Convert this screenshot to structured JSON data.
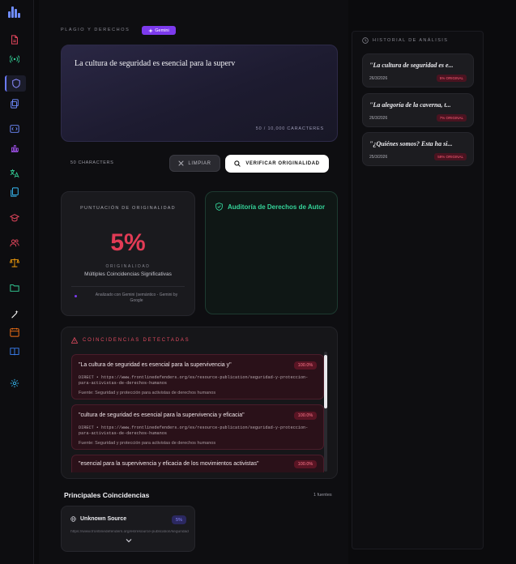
{
  "colors": {
    "accent": "#6b7bff",
    "danger": "#e23b55",
    "success": "#34d399",
    "gemini": "#7c3aed"
  },
  "sidebar": {
    "items": [
      {
        "name": "file-icon",
        "color": "#e2455c"
      },
      {
        "name": "broadcast-icon",
        "color": "#34d399"
      },
      {
        "name": "shield-icon",
        "color": "#8b8bff",
        "active": true
      },
      {
        "name": "copy-icon",
        "color": "#6f8cff"
      },
      {
        "name": "code-icon",
        "color": "#6f8cff"
      },
      {
        "name": "bar-chart-icon",
        "color": "#a855f7"
      },
      {
        "name": "translate-icon",
        "color": "#34d399"
      },
      {
        "name": "files-icon",
        "color": "#38bdf8"
      },
      {
        "name": "graduation-icon",
        "color": "#e2455c"
      },
      {
        "name": "users-icon",
        "color": "#e2455c"
      },
      {
        "name": "scale-icon",
        "color": "#f59e0b"
      },
      {
        "name": "folder-icon",
        "color": "#34d399"
      },
      {
        "name": "wand-icon",
        "color": "#ffffff"
      },
      {
        "name": "calendar-icon",
        "color": "#f97316"
      },
      {
        "name": "book-icon",
        "color": "#3b82f6"
      },
      {
        "name": "gear-icon",
        "color": "#38bdf8"
      }
    ]
  },
  "header": {
    "section": "Plagio y Derechos",
    "badge": "Gemini"
  },
  "editor": {
    "text": "La cultura de seguridad es esencial para la superv",
    "counter": "50 / 10,000 caracteres"
  },
  "toolbar": {
    "chars": "50 characters",
    "clear_label": "Limpiar",
    "verify_label": "Verificar originalidad"
  },
  "score": {
    "title": "Puntuación de Originalidad",
    "value": "5%",
    "label": "Originalidad",
    "message": "Múltiples Coincidencias Significativas",
    "analyzed": "Analizado con Gemini (semántico - Gemini by Google"
  },
  "audit": {
    "title": "Auditoría de Derechos de Autor"
  },
  "matches": {
    "title": "Coincidencias detectadas",
    "items": [
      {
        "quote": "\"La cultura de seguridad es esencial para la supervivencia y\"",
        "pct": "100.0%",
        "url": "DIRECT • https://www.frontlinedefenders.org/es/resource-publication/seguridad-y-proteccion-para-activistas-de-derechos-humanos",
        "source": "Fuente: Seguridad y protección para activistas de derechos humanos"
      },
      {
        "quote": "\"cultura de seguridad es esencial para la supervivencia y eficacia\"",
        "pct": "100.0%",
        "url": "DIRECT • https://www.frontlinedefenders.org/es/resource-publication/seguridad-y-proteccion-para-activistas-de-derechos-humanos",
        "source": "Fuente: Seguridad y protección para activistas de derechos humanos"
      },
      {
        "quote": "\"esencial para la supervivencia y eficacia de los movimientos activistas\"",
        "pct": "100.0%",
        "url": "",
        "source": ""
      }
    ]
  },
  "principal": {
    "title": "Principales Coincidencias",
    "count": "1 fuentes",
    "source_name": "Unknown Source",
    "source_pct": "5%",
    "source_url": "https://www.frontlinedefenders.org/es/resource-publication/seguridad-y-proteccion"
  },
  "history": {
    "title": "Historial de análisis",
    "items": [
      {
        "title": "\"La cultura de seguridad es e...",
        "date": "26/3/2026",
        "badge": "5% ORIGINAL"
      },
      {
        "title": "\"La alegoría de la caverna, t...",
        "date": "26/3/2026",
        "badge": "7% ORIGINAL"
      },
      {
        "title": "\"¿Quiénes somos? Esta ha si...",
        "date": "25/3/2026",
        "badge": "59% ORIGINAL"
      }
    ]
  }
}
